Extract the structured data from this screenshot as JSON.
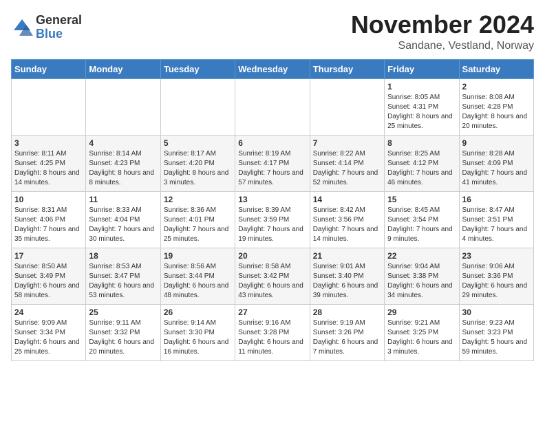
{
  "logo": {
    "general": "General",
    "blue": "Blue"
  },
  "title": "November 2024",
  "location": "Sandane, Vestland, Norway",
  "header_days": [
    "Sunday",
    "Monday",
    "Tuesday",
    "Wednesday",
    "Thursday",
    "Friday",
    "Saturday"
  ],
  "weeks": [
    [
      {
        "day": "",
        "content": ""
      },
      {
        "day": "",
        "content": ""
      },
      {
        "day": "",
        "content": ""
      },
      {
        "day": "",
        "content": ""
      },
      {
        "day": "",
        "content": ""
      },
      {
        "day": "1",
        "content": "Sunrise: 8:05 AM\nSunset: 4:31 PM\nDaylight: 8 hours and 25 minutes."
      },
      {
        "day": "2",
        "content": "Sunrise: 8:08 AM\nSunset: 4:28 PM\nDaylight: 8 hours and 20 minutes."
      }
    ],
    [
      {
        "day": "3",
        "content": "Sunrise: 8:11 AM\nSunset: 4:25 PM\nDaylight: 8 hours and 14 minutes."
      },
      {
        "day": "4",
        "content": "Sunrise: 8:14 AM\nSunset: 4:23 PM\nDaylight: 8 hours and 8 minutes."
      },
      {
        "day": "5",
        "content": "Sunrise: 8:17 AM\nSunset: 4:20 PM\nDaylight: 8 hours and 3 minutes."
      },
      {
        "day": "6",
        "content": "Sunrise: 8:19 AM\nSunset: 4:17 PM\nDaylight: 7 hours and 57 minutes."
      },
      {
        "day": "7",
        "content": "Sunrise: 8:22 AM\nSunset: 4:14 PM\nDaylight: 7 hours and 52 minutes."
      },
      {
        "day": "8",
        "content": "Sunrise: 8:25 AM\nSunset: 4:12 PM\nDaylight: 7 hours and 46 minutes."
      },
      {
        "day": "9",
        "content": "Sunrise: 8:28 AM\nSunset: 4:09 PM\nDaylight: 7 hours and 41 minutes."
      }
    ],
    [
      {
        "day": "10",
        "content": "Sunrise: 8:31 AM\nSunset: 4:06 PM\nDaylight: 7 hours and 35 minutes."
      },
      {
        "day": "11",
        "content": "Sunrise: 8:33 AM\nSunset: 4:04 PM\nDaylight: 7 hours and 30 minutes."
      },
      {
        "day": "12",
        "content": "Sunrise: 8:36 AM\nSunset: 4:01 PM\nDaylight: 7 hours and 25 minutes."
      },
      {
        "day": "13",
        "content": "Sunrise: 8:39 AM\nSunset: 3:59 PM\nDaylight: 7 hours and 19 minutes."
      },
      {
        "day": "14",
        "content": "Sunrise: 8:42 AM\nSunset: 3:56 PM\nDaylight: 7 hours and 14 minutes."
      },
      {
        "day": "15",
        "content": "Sunrise: 8:45 AM\nSunset: 3:54 PM\nDaylight: 7 hours and 9 minutes."
      },
      {
        "day": "16",
        "content": "Sunrise: 8:47 AM\nSunset: 3:51 PM\nDaylight: 7 hours and 4 minutes."
      }
    ],
    [
      {
        "day": "17",
        "content": "Sunrise: 8:50 AM\nSunset: 3:49 PM\nDaylight: 6 hours and 58 minutes."
      },
      {
        "day": "18",
        "content": "Sunrise: 8:53 AM\nSunset: 3:47 PM\nDaylight: 6 hours and 53 minutes."
      },
      {
        "day": "19",
        "content": "Sunrise: 8:56 AM\nSunset: 3:44 PM\nDaylight: 6 hours and 48 minutes."
      },
      {
        "day": "20",
        "content": "Sunrise: 8:58 AM\nSunset: 3:42 PM\nDaylight: 6 hours and 43 minutes."
      },
      {
        "day": "21",
        "content": "Sunrise: 9:01 AM\nSunset: 3:40 PM\nDaylight: 6 hours and 39 minutes."
      },
      {
        "day": "22",
        "content": "Sunrise: 9:04 AM\nSunset: 3:38 PM\nDaylight: 6 hours and 34 minutes."
      },
      {
        "day": "23",
        "content": "Sunrise: 9:06 AM\nSunset: 3:36 PM\nDaylight: 6 hours and 29 minutes."
      }
    ],
    [
      {
        "day": "24",
        "content": "Sunrise: 9:09 AM\nSunset: 3:34 PM\nDaylight: 6 hours and 25 minutes."
      },
      {
        "day": "25",
        "content": "Sunrise: 9:11 AM\nSunset: 3:32 PM\nDaylight: 6 hours and 20 minutes."
      },
      {
        "day": "26",
        "content": "Sunrise: 9:14 AM\nSunset: 3:30 PM\nDaylight: 6 hours and 16 minutes."
      },
      {
        "day": "27",
        "content": "Sunrise: 9:16 AM\nSunset: 3:28 PM\nDaylight: 6 hours and 11 minutes."
      },
      {
        "day": "28",
        "content": "Sunrise: 9:19 AM\nSunset: 3:26 PM\nDaylight: 6 hours and 7 minutes."
      },
      {
        "day": "29",
        "content": "Sunrise: 9:21 AM\nSunset: 3:25 PM\nDaylight: 6 hours and 3 minutes."
      },
      {
        "day": "30",
        "content": "Sunrise: 9:23 AM\nSunset: 3:23 PM\nDaylight: 5 hours and 59 minutes."
      }
    ]
  ]
}
